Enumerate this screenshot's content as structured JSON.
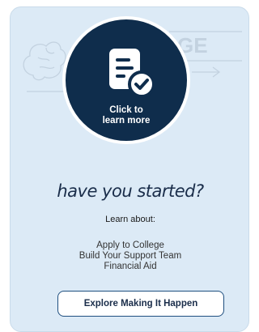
{
  "card": {
    "background_word": "GE",
    "cta_line1": "Click to",
    "cta_line2": "learn more",
    "headline": "have you started?",
    "learn_label": "Learn about:",
    "topics": [
      "Apply to College",
      "Build Your Support Team",
      "Financial Aid"
    ],
    "button_label": "Explore Making It Happen"
  },
  "colors": {
    "card_background": "#dceaf6",
    "circle": "#0f2d4c",
    "button_border": "#1f4f7f",
    "heading_text": "#1a2d4a"
  },
  "icons": {
    "cta_icon": "document-checkmark-icon",
    "background_sketch": "brain-sketch-icon"
  }
}
